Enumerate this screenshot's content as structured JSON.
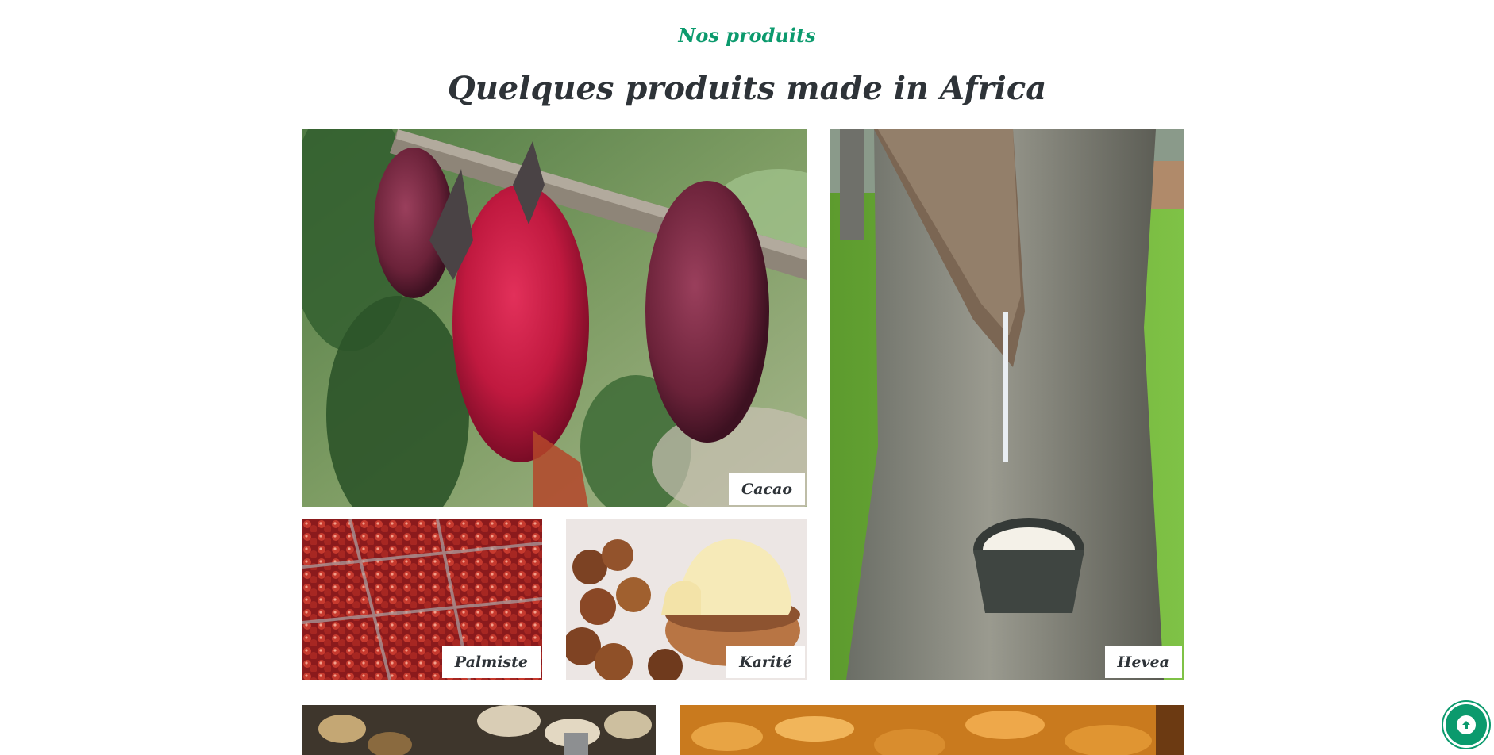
{
  "section": {
    "eyebrow": "Nos produits",
    "title": "Quelques produits made in Africa"
  },
  "products": [
    {
      "label": "Cacao"
    },
    {
      "label": "Palmiste"
    },
    {
      "label": "Karité"
    },
    {
      "label": "Hevea"
    }
  ],
  "colors": {
    "accent": "#0b9a6d",
    "heading": "#2e3338",
    "label_bg": "#ffffff"
  },
  "icons": {
    "scroll_top": "arrow-up-circle-icon"
  }
}
